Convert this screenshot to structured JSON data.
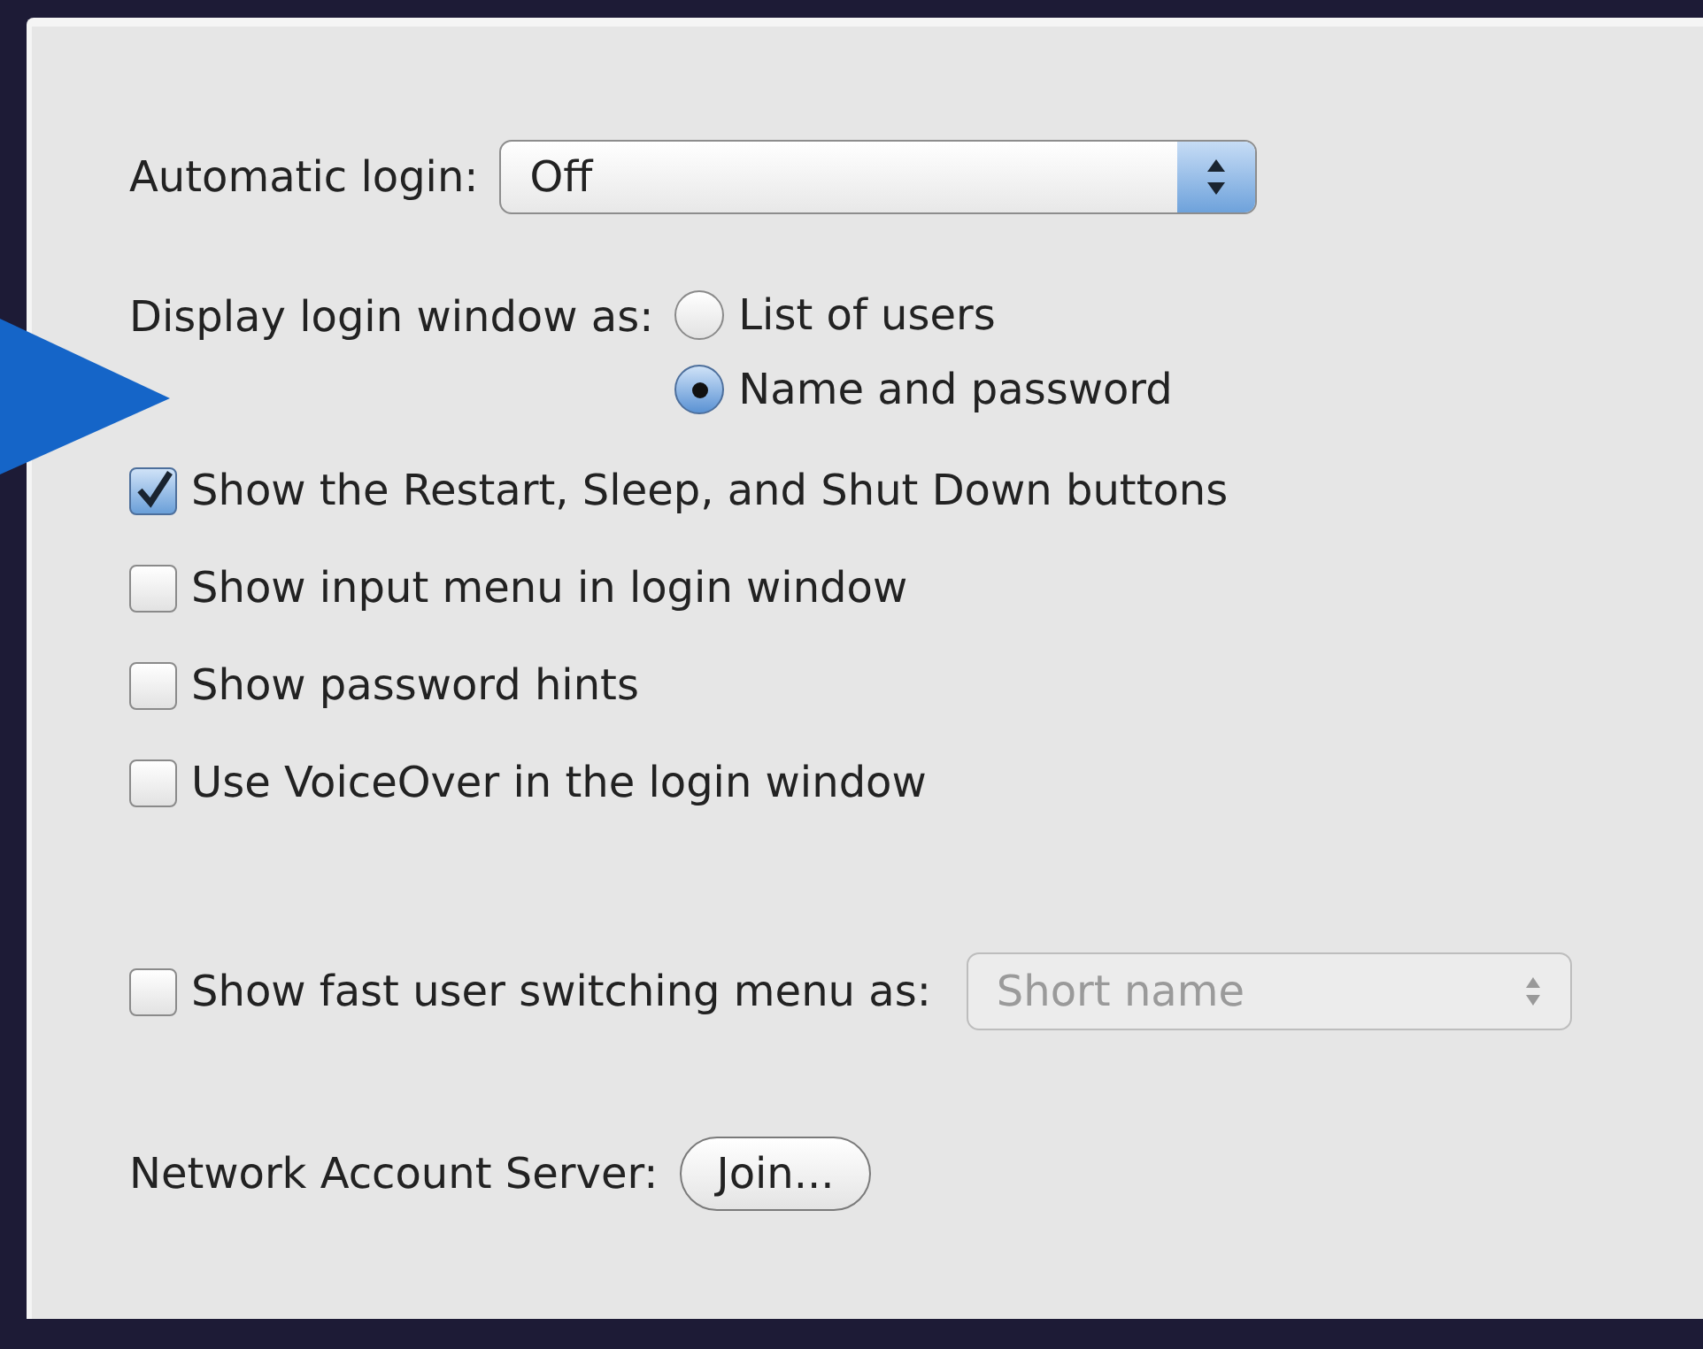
{
  "automatic_login": {
    "label": "Automatic login:",
    "value": "Off"
  },
  "display_login_window": {
    "label": "Display login window as:",
    "options": [
      {
        "label": "List of users",
        "selected": false
      },
      {
        "label": "Name and password",
        "selected": true
      }
    ]
  },
  "checkboxes": [
    {
      "label": "Show the Restart, Sleep, and Shut Down buttons",
      "checked": true
    },
    {
      "label": "Show input menu in login window",
      "checked": false
    },
    {
      "label": "Show password hints",
      "checked": false
    },
    {
      "label": "Use VoiceOver in the login window",
      "checked": false
    }
  ],
  "fast_user_switching": {
    "label": "Show fast user switching menu as:",
    "checked": false,
    "value": "Short name",
    "disabled": true
  },
  "network_account_server": {
    "label": "Network Account Server:",
    "button": "Join..."
  }
}
